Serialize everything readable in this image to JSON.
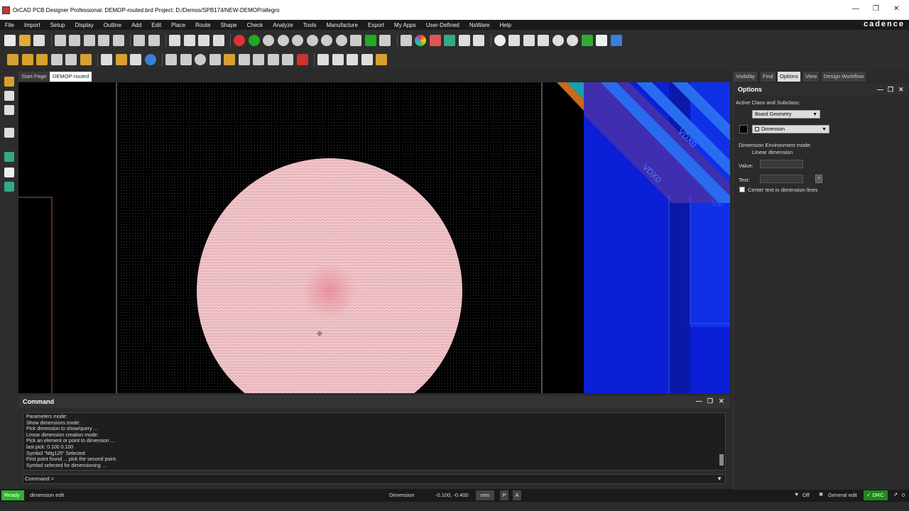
{
  "window": {
    "title": "OrCAD PCB Designer Professional: DEMOP-routed.brd  Project: D:/Demos/SPB174/NEW-DEMOP/allegro",
    "brand": "cadence"
  },
  "menu": [
    "File",
    "Import",
    "Setup",
    "Display",
    "Outline",
    "Add",
    "Edit",
    "Place",
    "Route",
    "Shape",
    "Check",
    "Analyze",
    "Tools",
    "Manufacture",
    "Export",
    "My Apps",
    "User-Defined",
    "NsWare",
    "Help"
  ],
  "tabs": [
    {
      "label": "Start Page",
      "active": false
    },
    {
      "label": "DEMOP-routed",
      "active": true
    }
  ],
  "canvas": {
    "net_labels": [
      "VDX0",
      "VDX0",
      "VD"
    ],
    "colors": {
      "pad": "#f2c8cc",
      "shape_blue": "#0b1fd6",
      "stripe_purple": "#4a2fa8",
      "stripe_blue": "#2a6cf0",
      "orange": "#c96a1c"
    }
  },
  "command": {
    "title": "Command",
    "log": [
      "Parameters mode:",
      "Show dimensions mode:",
      "Pick dimension to show/query ...",
      "Linear dimension creation mode:",
      "Pick an element or point to dimension ...",
      "last pick:  0.100 0.100",
      "Symbol \"Mtg125\" Selected",
      "First point found ... pick the second point.",
      "Symbol selected for dimensioning ..."
    ],
    "prompt": "Command >"
  },
  "status": {
    "ready": "Ready",
    "command": "dimension edit",
    "class": "Dimension",
    "coords": "-0.100, -0.400",
    "units": "mm",
    "p": "P",
    "a": "A",
    "filter": "Off",
    "mode": "General edit",
    "drc": "DRC",
    "count": "0"
  },
  "right_panel": {
    "tabs": [
      "Visibility",
      "Find",
      "Options",
      "View",
      "Design Workflow"
    ],
    "active_tab": "Options",
    "header": "Options",
    "active_class_label": "Active Class and Subclass:",
    "class_value": "Board Geometry",
    "subclass_value": "Dimension",
    "env_mode_label": "Dimension Environment mode:",
    "env_mode_value": "Linear dimension",
    "value_label": "Value:",
    "text_label": "Text:",
    "q_button": "?",
    "center_text_label": "Center text in dimension lines"
  }
}
